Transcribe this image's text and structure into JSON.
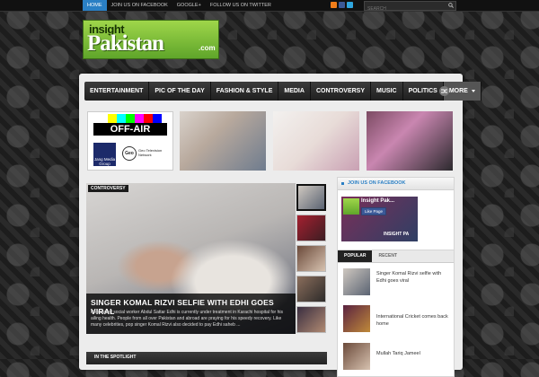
{
  "topbar": {
    "nav": [
      "HOME",
      "JOIN US ON FACEBOOK",
      "GOOGLE+",
      "FOLLOW US ON TWITTER"
    ],
    "search_placeholder": "SEARCH"
  },
  "logo": {
    "line1": "insight",
    "line2": "Pakistan",
    "line3": ".com"
  },
  "mainnav": [
    "ENTERTAINMENT",
    "PIC OF THE DAY",
    "FASHION & STYLE",
    "MEDIA",
    "CONTROVERSY",
    "MUSIC",
    "POLITICS",
    "MORE"
  ],
  "offair": {
    "label": "OFF-AIR",
    "jang": "Jang Media Group",
    "geo": "Geo",
    "geo_text": "Geo Television Network"
  },
  "feature": {
    "category": "CONTROVERSY",
    "title": "SINGER KOMAL RIZVI SELFIE WITH EDHI GOES VIRAL",
    "excerpt": "Renowned social worker Abdul Sattar Edhi is currently under treatment in Karachi hospital for his ailing health. People from all over Pakistan and abroad are praying for his speedy recovery. Like many celebrities, pop singer Komal Rizvi also decided to pay Edhi saheb ..."
  },
  "spotlight": {
    "label": "IN THE SPOTLIGHT"
  },
  "sidebar": {
    "fb_title": "JOIN US ON FACEBOOK",
    "fb_name": "Insight Pak...",
    "fb_like": "Like Page",
    "fb_banner": "INSIGHT PA",
    "tabs": [
      "POPULAR",
      "RECENT"
    ],
    "popular": [
      "Singer Komal Rizvi selfie with Edhi goes viral",
      "International Cricket comes back home",
      "Mullah Tariq Jameel"
    ]
  },
  "colors": {
    "accent": "#2a7fc4",
    "logo_green": "#7fbf3a",
    "nav_dark": "#2b2b2b"
  }
}
